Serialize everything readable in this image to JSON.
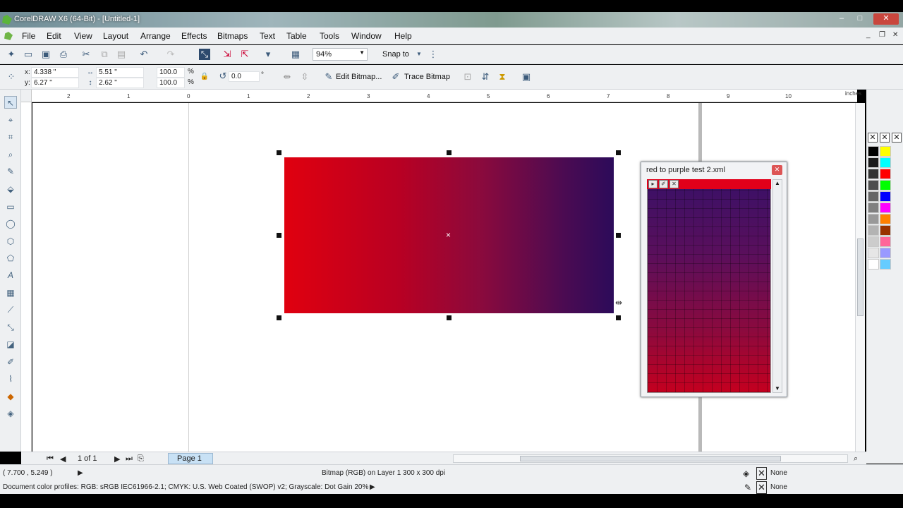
{
  "window": {
    "title": "CorelDRAW X6 (64-Bit) - [Untitled-1]",
    "minimize": "–",
    "maximize": "□",
    "close": "✕"
  },
  "menu": {
    "items": [
      "File",
      "Edit",
      "View",
      "Layout",
      "Arrange",
      "Effects",
      "Bitmaps",
      "Text",
      "Table",
      "Tools",
      "Window",
      "Help"
    ]
  },
  "toolbar": {
    "zoom": "94%",
    "snap_to": "Snap to"
  },
  "property_bar": {
    "x_label": "x:",
    "x_value": "4.338 \"",
    "y_label": "y:",
    "y_value": "6.27 \"",
    "width_value": "5.51 \"",
    "height_value": "2.62 \"",
    "scale_w": "100.0",
    "scale_h": "100.0",
    "percent": "%",
    "rotation": "0.0",
    "degree": "°",
    "edit_bitmap": "Edit Bitmap...",
    "trace_bitmap": "Trace Bitmap"
  },
  "ruler": {
    "ticks": [
      "2",
      "1",
      "0",
      "1",
      "2",
      "3",
      "4",
      "5",
      "6",
      "7",
      "8",
      "9",
      "10"
    ],
    "unit": "inches"
  },
  "docker": {
    "title": "red to purple test 2.xml",
    "close": "✕"
  },
  "navigator": {
    "page_count": "1 of 1",
    "page_tab": "Page 1"
  },
  "status": {
    "cursor_pos": "( 7.700 , 5.249 )",
    "object_info": "Bitmap (RGB) on Layer 1 300 x 300 dpi",
    "color_profiles": "Document color profiles: RGB: sRGB IEC61966-2.1; CMYK: U.S. Web Coated (SWOP) v2; Grayscale: Dot Gain 20%",
    "fill": "None",
    "outline": "None"
  },
  "palette": {
    "colors": [
      "#000000",
      "#1a1a1a",
      "#333333",
      "#4d4d4d",
      "#666666",
      "#808080",
      "#999999",
      "#b3b3b3",
      "#cccccc",
      "#e6e6e6",
      "#ffffff",
      "#ffff00",
      "#00ffff",
      "#ff0000",
      "#00ff00",
      "#0000ff",
      "#ff00ff",
      "#ff8000",
      "#993300",
      "#ff6699",
      "#9999ff",
      "#66ccff"
    ]
  }
}
